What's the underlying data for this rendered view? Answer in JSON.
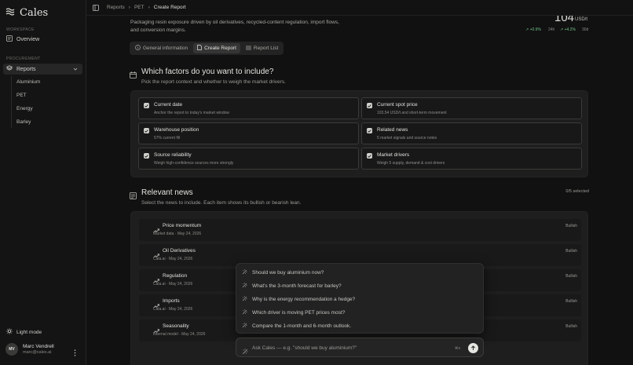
{
  "app": {
    "name": "Cales"
  },
  "sidebar": {
    "workspace_label": "WORKSPACE",
    "overview": "Overview",
    "procurement_label": "PROCUREMENT",
    "reports": "Reports",
    "sub_items": [
      "Aluminium",
      "PET",
      "Energy",
      "Barley"
    ],
    "light_mode": "Light mode",
    "user": {
      "initials": "MV",
      "name": "Marc Vendrell",
      "email": "marc@cales.ai"
    }
  },
  "breadcrumb": [
    "Reports",
    "PET",
    "Create Report"
  ],
  "header": {
    "description": "Packaging resin exposure driven by oil derivatives, recycled-content regulation, import flows, and conversion margins.",
    "price": "104",
    "unit": "USD/t",
    "change_24h": "+0.9%",
    "label_24h": "24h",
    "change_30d": "+4.2%",
    "label_30d": "30d"
  },
  "tabs": [
    "General information",
    "Create Report",
    "Report List"
  ],
  "factors": {
    "title": "Which factors do you want to include?",
    "subtitle": "Pick the report context and whether to weigh the market drivers.",
    "items": [
      {
        "title": "Current date",
        "desc": "Anchor the report to today's market window"
      },
      {
        "title": "Current spot price",
        "desc": "103.54 USD/t and short-term movement"
      },
      {
        "title": "Warehouse position",
        "desc": "57% current fill"
      },
      {
        "title": "Related news",
        "desc": "5 market signals and source notes"
      },
      {
        "title": "Source reliability",
        "desc": "Weigh high-confidence sources more strongly"
      },
      {
        "title": "Market drivers",
        "desc": "Weigh 5 supply, demand & cost drivers"
      }
    ]
  },
  "news": {
    "title": "Relevant news",
    "subtitle": "Select the news to include. Each item shows its bullish or bearish lean.",
    "selected": "0/5 selected",
    "items": [
      {
        "title": "Price momentum",
        "meta": "Market data · May 24, 2026",
        "lean": "Bullish"
      },
      {
        "title": "Oil Derivatives",
        "meta": "Cala.ai · May 24, 2026",
        "lean": "Bullish"
      },
      {
        "title": "Regulation",
        "meta": "Cala.ai · May 24, 2026",
        "lean": "Bullish"
      },
      {
        "title": "Imports",
        "meta": "Cala.ai · May 24, 2026",
        "lean": "Bullish"
      },
      {
        "title": "Seasonality",
        "meta": "Internal model · May 24, 2026",
        "lean": "Bullish"
      }
    ]
  },
  "suggestions": [
    "Should we buy aluminium now?",
    "What's the 3-month forecast for barley?",
    "Why is the energy recommendation a hedge?",
    "Which driver is moving PET prices most?",
    "Compare the 1-month and 6-month outlook."
  ],
  "ask": {
    "placeholder": "Ask Cales — e.g. \"should we buy aluminium?\"",
    "shortcut": "⌘K"
  },
  "colors": {
    "accent_up": "#72c08a",
    "background": "#111111"
  }
}
